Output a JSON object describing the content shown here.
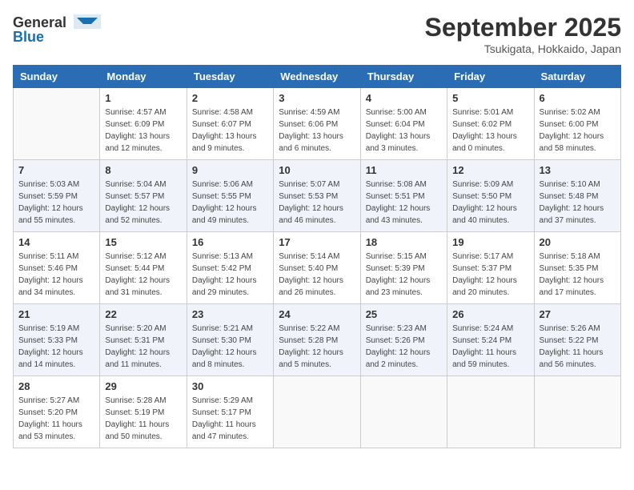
{
  "header": {
    "logo_general": "General",
    "logo_blue": "Blue",
    "month": "September 2025",
    "location": "Tsukigata, Hokkaido, Japan"
  },
  "weekdays": [
    "Sunday",
    "Monday",
    "Tuesday",
    "Wednesday",
    "Thursday",
    "Friday",
    "Saturday"
  ],
  "weeks": [
    [
      {
        "day": "",
        "info": ""
      },
      {
        "day": "1",
        "info": "Sunrise: 4:57 AM\nSunset: 6:09 PM\nDaylight: 13 hours\nand 12 minutes."
      },
      {
        "day": "2",
        "info": "Sunrise: 4:58 AM\nSunset: 6:07 PM\nDaylight: 13 hours\nand 9 minutes."
      },
      {
        "day": "3",
        "info": "Sunrise: 4:59 AM\nSunset: 6:06 PM\nDaylight: 13 hours\nand 6 minutes."
      },
      {
        "day": "4",
        "info": "Sunrise: 5:00 AM\nSunset: 6:04 PM\nDaylight: 13 hours\nand 3 minutes."
      },
      {
        "day": "5",
        "info": "Sunrise: 5:01 AM\nSunset: 6:02 PM\nDaylight: 13 hours\nand 0 minutes."
      },
      {
        "day": "6",
        "info": "Sunrise: 5:02 AM\nSunset: 6:00 PM\nDaylight: 12 hours\nand 58 minutes."
      }
    ],
    [
      {
        "day": "7",
        "info": "Sunrise: 5:03 AM\nSunset: 5:59 PM\nDaylight: 12 hours\nand 55 minutes."
      },
      {
        "day": "8",
        "info": "Sunrise: 5:04 AM\nSunset: 5:57 PM\nDaylight: 12 hours\nand 52 minutes."
      },
      {
        "day": "9",
        "info": "Sunrise: 5:06 AM\nSunset: 5:55 PM\nDaylight: 12 hours\nand 49 minutes."
      },
      {
        "day": "10",
        "info": "Sunrise: 5:07 AM\nSunset: 5:53 PM\nDaylight: 12 hours\nand 46 minutes."
      },
      {
        "day": "11",
        "info": "Sunrise: 5:08 AM\nSunset: 5:51 PM\nDaylight: 12 hours\nand 43 minutes."
      },
      {
        "day": "12",
        "info": "Sunrise: 5:09 AM\nSunset: 5:50 PM\nDaylight: 12 hours\nand 40 minutes."
      },
      {
        "day": "13",
        "info": "Sunrise: 5:10 AM\nSunset: 5:48 PM\nDaylight: 12 hours\nand 37 minutes."
      }
    ],
    [
      {
        "day": "14",
        "info": "Sunrise: 5:11 AM\nSunset: 5:46 PM\nDaylight: 12 hours\nand 34 minutes."
      },
      {
        "day": "15",
        "info": "Sunrise: 5:12 AM\nSunset: 5:44 PM\nDaylight: 12 hours\nand 31 minutes."
      },
      {
        "day": "16",
        "info": "Sunrise: 5:13 AM\nSunset: 5:42 PM\nDaylight: 12 hours\nand 29 minutes."
      },
      {
        "day": "17",
        "info": "Sunrise: 5:14 AM\nSunset: 5:40 PM\nDaylight: 12 hours\nand 26 minutes."
      },
      {
        "day": "18",
        "info": "Sunrise: 5:15 AM\nSunset: 5:39 PM\nDaylight: 12 hours\nand 23 minutes."
      },
      {
        "day": "19",
        "info": "Sunrise: 5:17 AM\nSunset: 5:37 PM\nDaylight: 12 hours\nand 20 minutes."
      },
      {
        "day": "20",
        "info": "Sunrise: 5:18 AM\nSunset: 5:35 PM\nDaylight: 12 hours\nand 17 minutes."
      }
    ],
    [
      {
        "day": "21",
        "info": "Sunrise: 5:19 AM\nSunset: 5:33 PM\nDaylight: 12 hours\nand 14 minutes."
      },
      {
        "day": "22",
        "info": "Sunrise: 5:20 AM\nSunset: 5:31 PM\nDaylight: 12 hours\nand 11 minutes."
      },
      {
        "day": "23",
        "info": "Sunrise: 5:21 AM\nSunset: 5:30 PM\nDaylight: 12 hours\nand 8 minutes."
      },
      {
        "day": "24",
        "info": "Sunrise: 5:22 AM\nSunset: 5:28 PM\nDaylight: 12 hours\nand 5 minutes."
      },
      {
        "day": "25",
        "info": "Sunrise: 5:23 AM\nSunset: 5:26 PM\nDaylight: 12 hours\nand 2 minutes."
      },
      {
        "day": "26",
        "info": "Sunrise: 5:24 AM\nSunset: 5:24 PM\nDaylight: 11 hours\nand 59 minutes."
      },
      {
        "day": "27",
        "info": "Sunrise: 5:26 AM\nSunset: 5:22 PM\nDaylight: 11 hours\nand 56 minutes."
      }
    ],
    [
      {
        "day": "28",
        "info": "Sunrise: 5:27 AM\nSunset: 5:20 PM\nDaylight: 11 hours\nand 53 minutes."
      },
      {
        "day": "29",
        "info": "Sunrise: 5:28 AM\nSunset: 5:19 PM\nDaylight: 11 hours\nand 50 minutes."
      },
      {
        "day": "30",
        "info": "Sunrise: 5:29 AM\nSunset: 5:17 PM\nDaylight: 11 hours\nand 47 minutes."
      },
      {
        "day": "",
        "info": ""
      },
      {
        "day": "",
        "info": ""
      },
      {
        "day": "",
        "info": ""
      },
      {
        "day": "",
        "info": ""
      }
    ]
  ]
}
